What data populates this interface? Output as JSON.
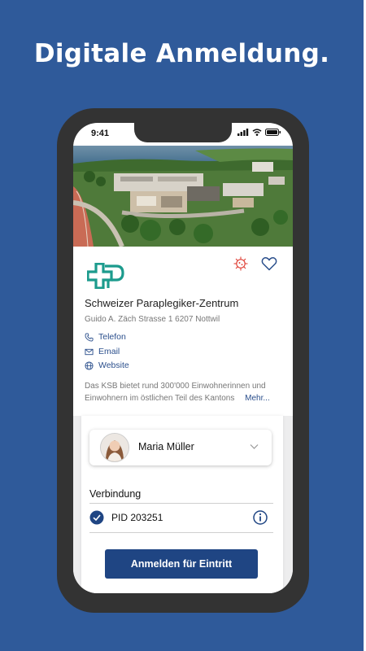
{
  "headline": "Digitale Anmeldung.",
  "status_bar": {
    "time": "9:41"
  },
  "clinic": {
    "name": "Schweizer Paraplegiker-Zentrum",
    "address": "Guido A. Zäch Strasse 1 6207 Nottwil",
    "contacts": [
      {
        "label": "Telefon",
        "icon": "phone-icon"
      },
      {
        "label": "Email",
        "icon": "mail-icon"
      },
      {
        "label": "Website",
        "icon": "globe-icon"
      }
    ],
    "description": "Das KSB bietet rund 300'000 Einwohnerinnen und Einwohnern im östlichen Teil des Kantons",
    "more_label": "Mehr..."
  },
  "user": {
    "name": "Maria Müller"
  },
  "connection": {
    "label": "Verbindung",
    "pid": "PID 203251"
  },
  "submit_label": "Anmelden für Eintritt",
  "colors": {
    "background": "#2f5a9a",
    "accent": "#1f4583",
    "logo": "#1c9b8d",
    "virus": "#e0443a"
  }
}
